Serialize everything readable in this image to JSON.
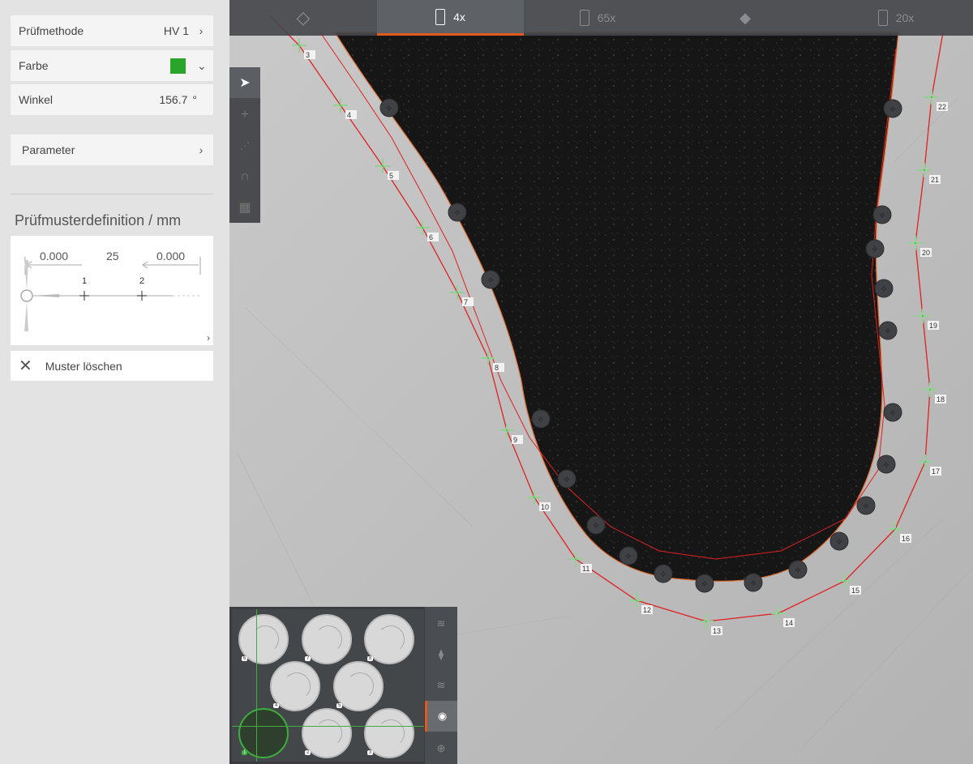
{
  "panel": {
    "method_label": "Prüfmethode",
    "method_value": "HV 1",
    "color_label": "Farbe",
    "color_value": "#2aa52a",
    "angle_label": "Winkel",
    "angle_value": "156.7",
    "angle_unit": "°",
    "params_label": "Parameter",
    "pattern_title": "Prüfmusterdefinition / mm",
    "pattern": {
      "left_offset": "0.000",
      "count": "25",
      "right_offset": "0.000",
      "point_labels": [
        "1",
        "2"
      ]
    },
    "delete_label": "Muster löschen"
  },
  "tabs": [
    {
      "id": "nav",
      "label": "",
      "icon": "navigation-icon"
    },
    {
      "id": "4x",
      "label": "4x",
      "icon": "objective-icon",
      "active": true
    },
    {
      "id": "65x",
      "label": "65x",
      "icon": "objective-icon"
    },
    {
      "id": "focus",
      "label": "",
      "icon": "focus-icon"
    },
    {
      "id": "20x",
      "label": "20x",
      "icon": "objective-icon"
    }
  ],
  "tools": [
    "cursor-icon",
    "crosshair-icon",
    "line-points-icon",
    "arc-cursor-icon",
    "grid-pattern-icon"
  ],
  "indent_points": [
    "3",
    "4",
    "5",
    "6",
    "7",
    "8",
    "9",
    "10",
    "11",
    "12",
    "13",
    "14",
    "15",
    "16",
    "17",
    "18",
    "19",
    "20",
    "21",
    "22"
  ],
  "minimap": {
    "sample_labels": [
      "6",
      "7",
      "8",
      "4",
      "5",
      "1",
      "2",
      "3"
    ],
    "side_buttons": [
      "layers-a-icon",
      "layers-b-icon",
      "layers-c-icon",
      "sample-stack-icon",
      "position-icon"
    ]
  },
  "colors": {
    "accent": "#e05a1c",
    "pattern": "#2aa52a",
    "path": "#e02020"
  }
}
